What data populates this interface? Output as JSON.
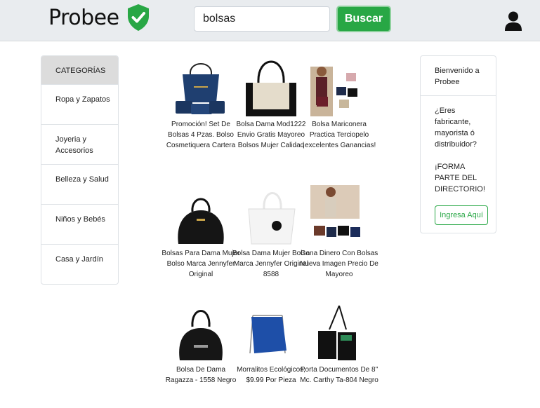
{
  "header": {
    "brand": "Probee",
    "search_value": "bolsas",
    "search_button": "Buscar"
  },
  "sidebar": {
    "header": "CATEGORÍAS",
    "items": [
      {
        "label": "Ropa y Zapatos"
      },
      {
        "label": "Joyeria y Accesorios"
      },
      {
        "label": "Belleza y Salud"
      },
      {
        "label": "Niños y Bebés"
      },
      {
        "label": "Casa y Jardín"
      }
    ]
  },
  "products": [
    {
      "title": "Promoción! Set De Bolsas 4 Pzas. Bolso Cosmetiquera Cartera"
    },
    {
      "title": "Bolsa Dama Mod1222 Envio Gratis Mayoreo Bolsos Mujer Calidad"
    },
    {
      "title": "Bolsa Mariconera Practica Terciopelo ¡excelentes Ganancias!"
    },
    {
      "title": "Bolsas Para Dama Mujer Bolso Marca Jennyfer Original"
    },
    {
      "title": "Bolsa Dama Mujer Bolso Marca Jennyfer Original 8588"
    },
    {
      "title": "Gana Dinero Con Bolsas Nueva Imagen Precio De Mayoreo"
    },
    {
      "title": "Bolsa De Dama Ragazza - 1558 Negro"
    },
    {
      "title": "Morralitos Ecológicos, $9.99 Por Pieza"
    },
    {
      "title": "Porta Documentos De 8\" Mc. Carthy Ta-804 Negro"
    }
  ],
  "welcome": {
    "greeting": "Bienvenido a Probee",
    "question": "¿Eres fabricante, mayorista ó distribuidor?",
    "pitch": "¡FORMA PARTE DEL DIRECTORIO!",
    "cta": "Ingresa Aquí"
  },
  "colors": {
    "accent": "#28a745",
    "topbar": "#e9ecef"
  },
  "icons": [
    "shield-check-icon",
    "user-icon"
  ]
}
